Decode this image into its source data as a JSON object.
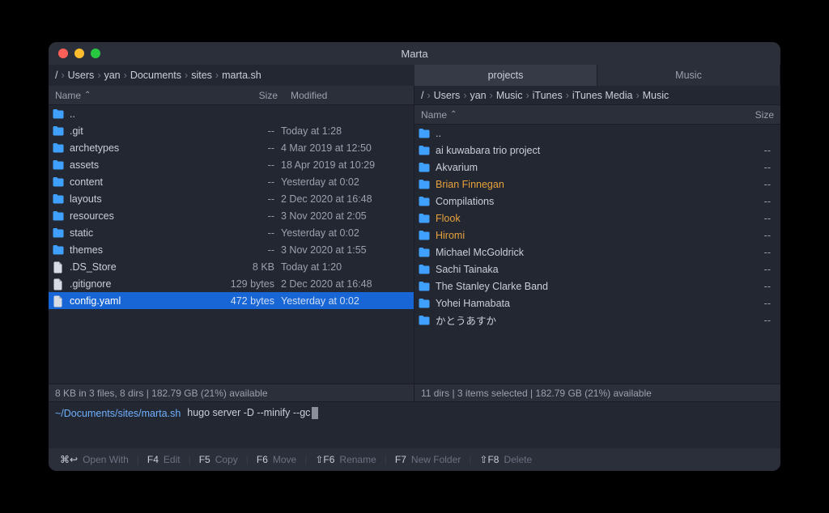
{
  "app": {
    "title": "Marta"
  },
  "left": {
    "breadcrumb": [
      "/",
      "Users",
      "yan",
      "Documents",
      "sites",
      "marta.sh"
    ],
    "columns": {
      "name": "Name",
      "size": "Size",
      "modified": "Modified"
    },
    "rows": [
      {
        "type": "folder",
        "name": "..",
        "size": "",
        "mod": ""
      },
      {
        "type": "folder",
        "name": ".git",
        "size": "--",
        "mod": "Today at 1:28"
      },
      {
        "type": "folder",
        "name": "archetypes",
        "size": "--",
        "mod": "4 Mar 2019 at 12:50"
      },
      {
        "type": "folder",
        "name": "assets",
        "size": "--",
        "mod": "18 Apr 2019 at 10:29"
      },
      {
        "type": "folder",
        "name": "content",
        "size": "--",
        "mod": "Yesterday at 0:02"
      },
      {
        "type": "folder",
        "name": "layouts",
        "size": "--",
        "mod": "2 Dec 2020 at 16:48"
      },
      {
        "type": "folder",
        "name": "resources",
        "size": "--",
        "mod": "3 Nov 2020 at 2:05"
      },
      {
        "type": "folder",
        "name": "static",
        "size": "--",
        "mod": "Yesterday at 0:02"
      },
      {
        "type": "folder",
        "name": "themes",
        "size": "--",
        "mod": "3 Nov 2020 at 1:55"
      },
      {
        "type": "file",
        "name": ".DS_Store",
        "size": "8 KB",
        "mod": "Today at 1:20"
      },
      {
        "type": "file",
        "name": ".gitignore",
        "size": "129 bytes",
        "mod": "2 Dec 2020 at 16:48"
      },
      {
        "type": "file",
        "name": "config.yaml",
        "size": "472 bytes",
        "mod": "Yesterday at 0:02",
        "selected": true
      }
    ],
    "status": "8 KB in 3 files, 8 dirs  |  182.79 GB (21%) available"
  },
  "right": {
    "tabs": [
      {
        "label": "projects",
        "active": true
      },
      {
        "label": "Music",
        "active": false
      }
    ],
    "breadcrumb": [
      "/",
      "Users",
      "yan",
      "Music",
      "iTunes",
      "iTunes Media",
      "Music"
    ],
    "columns": {
      "name": "Name",
      "size": "Size"
    },
    "rows": [
      {
        "type": "folder",
        "name": "..",
        "size": ""
      },
      {
        "type": "folder",
        "name": "ai kuwabara trio project",
        "size": "--"
      },
      {
        "type": "folder",
        "name": "Akvarium",
        "size": "--"
      },
      {
        "type": "folder",
        "name": "Brian Finnegan",
        "size": "--",
        "highlighted": true
      },
      {
        "type": "folder",
        "name": "Compilations",
        "size": "--"
      },
      {
        "type": "folder",
        "name": "Flook",
        "size": "--",
        "highlighted": true
      },
      {
        "type": "folder",
        "name": "Hiromi",
        "size": "--",
        "highlighted": true
      },
      {
        "type": "folder",
        "name": "Michael McGoldrick",
        "size": "--"
      },
      {
        "type": "folder",
        "name": "Sachi Tainaka",
        "size": "--"
      },
      {
        "type": "folder",
        "name": "The Stanley Clarke Band",
        "size": "--"
      },
      {
        "type": "folder",
        "name": "Yohei Hamabata",
        "size": "--"
      },
      {
        "type": "folder",
        "name": "かとうあすか",
        "size": "--"
      }
    ],
    "status": "11 dirs  |  3 items selected  |  182.79 GB (21%) available"
  },
  "terminal": {
    "prompt": "~/Documents/sites/marta.sh",
    "value": "hugo server -D --minify --gc"
  },
  "fnbar": [
    {
      "key": "⌘↩",
      "label": "Open With"
    },
    {
      "key": "F4",
      "label": "Edit"
    },
    {
      "key": "F5",
      "label": "Copy"
    },
    {
      "key": "F6",
      "label": "Move"
    },
    {
      "key": "⇧F6",
      "label": "Rename"
    },
    {
      "key": "F7",
      "label": "New Folder"
    },
    {
      "key": "⇧F8",
      "label": "Delete"
    }
  ]
}
